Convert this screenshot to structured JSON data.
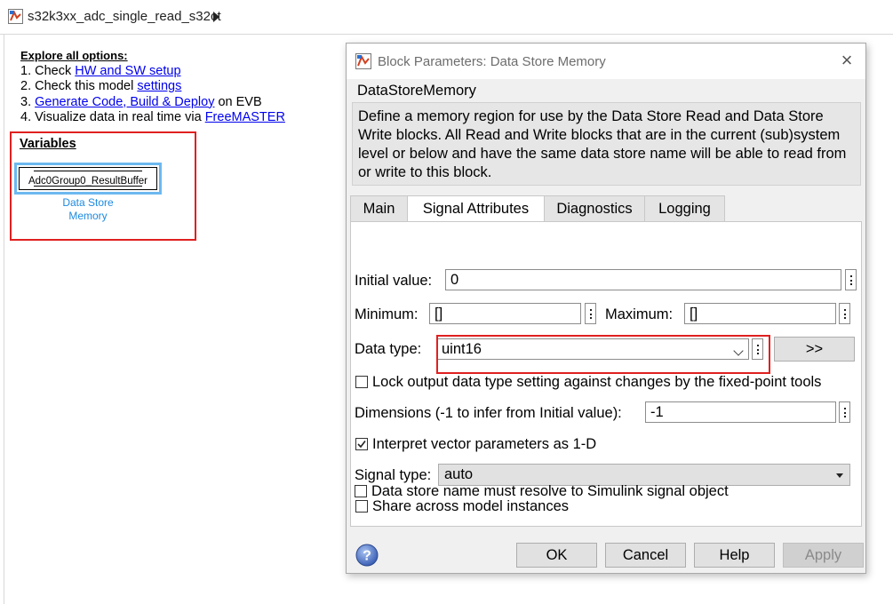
{
  "breadcrumb": {
    "model_name": "s32k3xx_adc_single_read_s32ct"
  },
  "explore": {
    "heading": "Explore all options:",
    "step1_prefix": "1. Check ",
    "step1_link": "HW and SW setup",
    "step2_prefix": "2. Check this model ",
    "step2_link": "settings",
    "step3_prefix": "3. ",
    "step3_link": "Generate Code, Build & Deploy",
    "step3_suffix": " on EVB",
    "step4_prefix": "4. Visualize data in real time via ",
    "step4_link": "FreeMASTER"
  },
  "variables": {
    "title": "Variables",
    "block_name": "Adc0Group0_ResultBuffer",
    "block_caption_line1": "Data Store",
    "block_caption_line2": "Memory"
  },
  "dialog": {
    "title": "Block Parameters: Data Store Memory",
    "block_type": "DataStoreMemory",
    "description": "Define a memory region for use by the Data Store Read and Data Store Write blocks. All Read and Write blocks that are in the current (sub)system level or below and have the same data store name will be able to read from or write to this block.",
    "tabs": [
      {
        "label": "Main"
      },
      {
        "label": "Signal Attributes"
      },
      {
        "label": "Diagnostics"
      },
      {
        "label": "Logging"
      }
    ],
    "active_tab": "Signal Attributes",
    "initial_value_label": "Initial value:",
    "initial_value": "0",
    "minimum_label": "Minimum:",
    "minimum_value": "[]",
    "maximum_label": "Maximum:",
    "maximum_value": "[]",
    "data_type_label": "Data type:",
    "data_type_value": "uint16",
    "data_type_button": ">>",
    "lock_label": "Lock output data type setting against changes by the fixed-point tools",
    "lock_checked": false,
    "dimensions_label": "Dimensions (-1 to infer from Initial value):",
    "dimensions_value": "-1",
    "interpret_label": "Interpret vector parameters as 1-D",
    "interpret_checked": true,
    "signal_type_label": "Signal type:",
    "signal_type_value": "auto",
    "share_label": "Share across model instances",
    "share_checked": false,
    "resolve_label": "Data store name must resolve to Simulink signal object",
    "resolve_checked": false,
    "buttons": {
      "ok": "OK",
      "cancel": "Cancel",
      "help": "Help",
      "apply": "Apply"
    }
  },
  "colors": {
    "highlight_red": "#e02020",
    "link_blue": "#0000ee",
    "block_caption_blue": "#1e8ae0",
    "block_border_blue": "#6cb8f0"
  }
}
